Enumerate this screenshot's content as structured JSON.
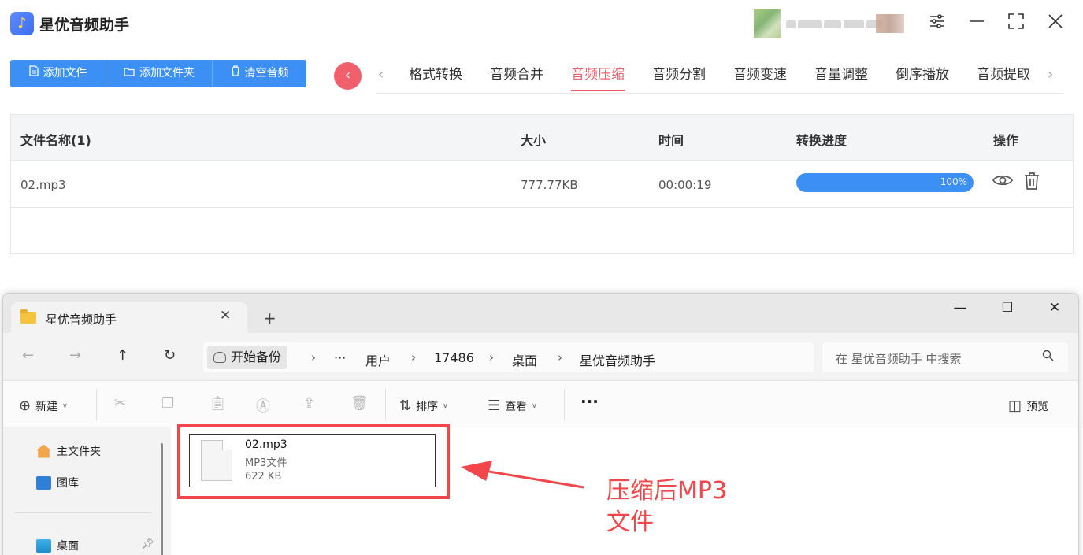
{
  "app": {
    "title": "星优音频助手",
    "logo_glyph": "♪",
    "window_controls": [
      "settings-sliders",
      "minimize",
      "maximize",
      "close"
    ]
  },
  "toolbar": {
    "add_file": "添加文件",
    "add_folder": "添加文件夹",
    "clear_audio": "清空音频"
  },
  "tabs": {
    "items": [
      "格式转换",
      "音频合并",
      "音频压缩",
      "音频分割",
      "音频变速",
      "音量调整",
      "倒序播放",
      "音频提取"
    ],
    "active": "音频压缩"
  },
  "table": {
    "headers": {
      "name": "文件名称(1)",
      "size": "大小",
      "time": "时间",
      "progress": "转换进度",
      "actions": "操作"
    },
    "rows": [
      {
        "name": "02.mp3",
        "size": "777.77KB",
        "time": "00:00:19",
        "progress": 1.0,
        "progress_label": "100%"
      }
    ]
  },
  "explorer": {
    "tab_title": "星优音频助手",
    "address_chip": "开始备份",
    "breadcrumb": {
      "ellipsis": "···",
      "b1": "用户",
      "b2": "17486",
      "b3": "桌面",
      "b4": "星优音频助手"
    },
    "search_placeholder": "在 星优音频助手 中搜索",
    "commands": {
      "new": "新建",
      "sort": "排序",
      "view": "查看",
      "more": "···",
      "preview": "预览"
    },
    "sidebar": {
      "home": "主文件夹",
      "gallery": "图库",
      "desktop": "桌面"
    },
    "file": {
      "name": "02.mp3",
      "type": "MP3文件",
      "size": "622 KB"
    }
  },
  "annotation": {
    "line1": "压缩后MP3",
    "line2": "文件",
    "color": "#f2464a"
  },
  "colors": {
    "primary": "#3b8ff5",
    "accent": "#f0606c"
  }
}
